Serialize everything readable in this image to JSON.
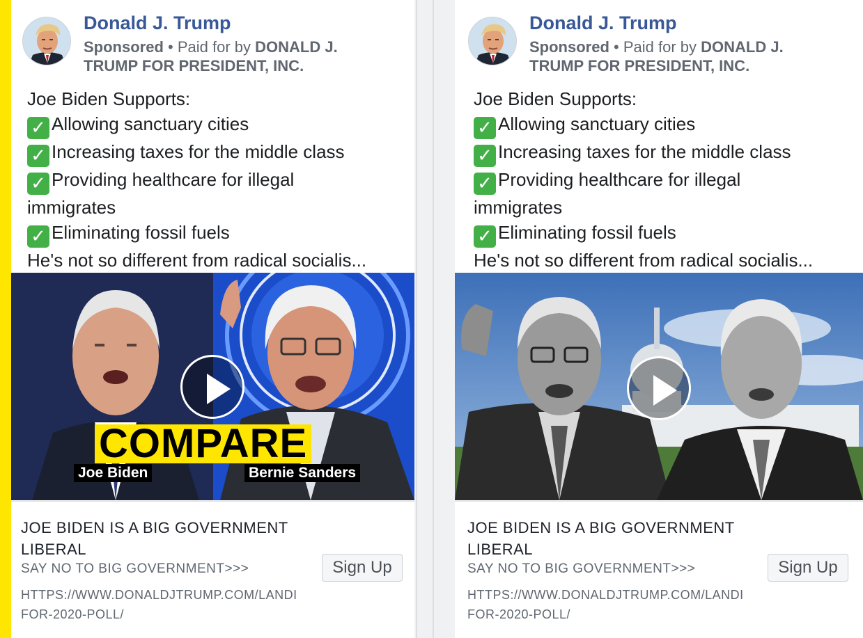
{
  "colors": {
    "highlight_bar": "#ffe600",
    "page_name": "#385898",
    "check_green": "#43b047"
  },
  "ads": [
    {
      "page_name": "Donald J. Trump",
      "sponsored_label": "Sponsored",
      "separator": "•",
      "paid_for_prefix": "Paid for by",
      "paid_for_by": "DONALD J. TRUMP FOR PRESIDENT, INC.",
      "body_intro": "Joe Biden Supports:",
      "check_icon": "white-check-mark-icon",
      "bullets": [
        "Allowing sanctuary cities",
        "Increasing taxes for the middle class",
        "Providing healthcare for illegal"
      ],
      "wrap_line": "immigrates",
      "last_bullet": "Eliminating fossil fuels",
      "truncated_line": "He's not so different from radical socialis...",
      "video": {
        "overlay_text": "COMPARE",
        "caption_left": "Joe Biden",
        "caption_right": "Bernie Sanders"
      },
      "link_headline": "JOE BIDEN IS A BIG GOVERNMENT LIBERAL",
      "link_description": "SAY NO TO BIG GOVERNMENT>>>",
      "link_url": "HTTPS://WWW.DONALDJTRUMP.COM/LANDI FOR-2020-POLL/",
      "cta_label": "Sign Up"
    },
    {
      "page_name": "Donald J. Trump",
      "sponsored_label": "Sponsored",
      "separator": "•",
      "paid_for_prefix": "Paid for by",
      "paid_for_by": "DONALD J. TRUMP FOR PRESIDENT, INC.",
      "body_intro": "Joe Biden Supports:",
      "check_icon": "white-check-mark-icon",
      "bullets": [
        "Allowing sanctuary cities",
        "Increasing taxes for the middle class",
        "Providing healthcare for illegal"
      ],
      "wrap_line": "immigrates",
      "last_bullet": "Eliminating fossil fuels",
      "truncated_line": "He's not so different from radical socialis...",
      "link_headline": "JOE BIDEN IS A BIG GOVERNMENT LIBERAL",
      "link_description": "SAY NO TO BIG GOVERNMENT>>>",
      "link_url": "HTTPS://WWW.DONALDJTRUMP.COM/LANDI FOR-2020-POLL/",
      "cta_label": "Sign Up"
    }
  ]
}
